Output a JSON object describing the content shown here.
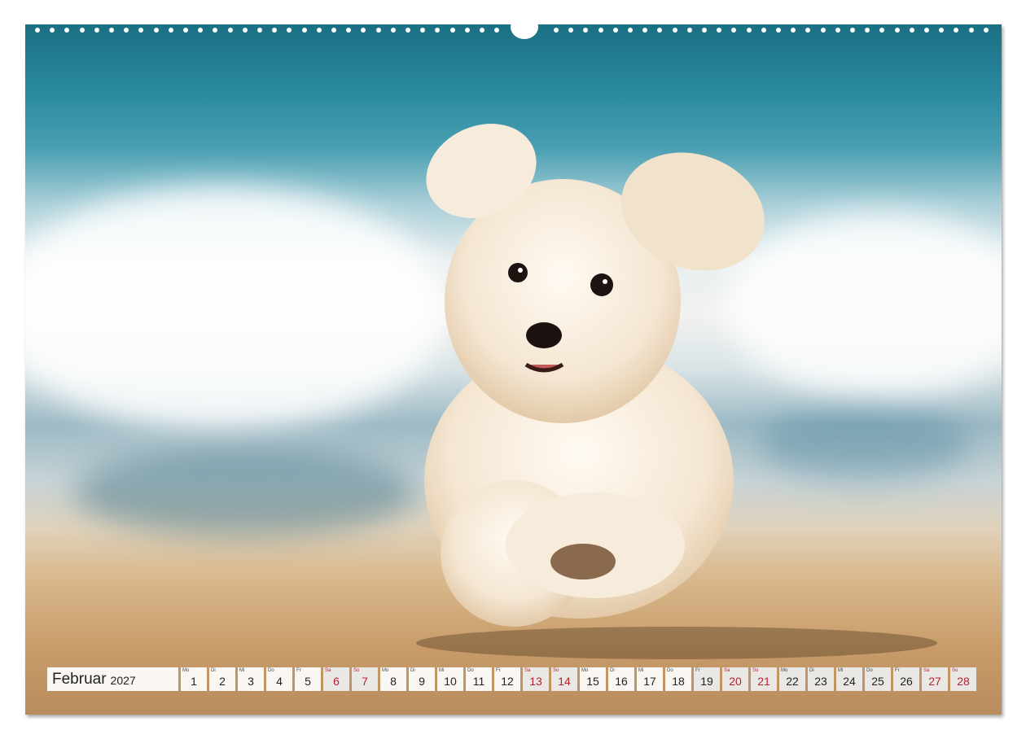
{
  "calendar": {
    "month": "Februar",
    "year": "2027",
    "days": [
      {
        "wd": "Mo",
        "d": "1",
        "type": "weekday"
      },
      {
        "wd": "Di",
        "d": "2",
        "type": "weekday"
      },
      {
        "wd": "Mi",
        "d": "3",
        "type": "weekday"
      },
      {
        "wd": "Do",
        "d": "4",
        "type": "weekday"
      },
      {
        "wd": "Fr",
        "d": "5",
        "type": "weekday"
      },
      {
        "wd": "Sa",
        "d": "6",
        "type": "sunday"
      },
      {
        "wd": "So",
        "d": "7",
        "type": "sunday"
      },
      {
        "wd": "Mo",
        "d": "8",
        "type": "weekday"
      },
      {
        "wd": "Di",
        "d": "9",
        "type": "weekday"
      },
      {
        "wd": "Mi",
        "d": "10",
        "type": "weekday"
      },
      {
        "wd": "Do",
        "d": "11",
        "type": "weekday"
      },
      {
        "wd": "Fr",
        "d": "12",
        "type": "weekday"
      },
      {
        "wd": "Sa",
        "d": "13",
        "type": "sunday"
      },
      {
        "wd": "So",
        "d": "14",
        "type": "sunday"
      },
      {
        "wd": "Mo",
        "d": "15",
        "type": "weekday"
      },
      {
        "wd": "Di",
        "d": "16",
        "type": "weekday"
      },
      {
        "wd": "Mi",
        "d": "17",
        "type": "weekday"
      },
      {
        "wd": "Do",
        "d": "18",
        "type": "weekday"
      },
      {
        "wd": "Fr",
        "d": "19",
        "type": "weekend"
      },
      {
        "wd": "Sa",
        "d": "20",
        "type": "sunday"
      },
      {
        "wd": "So",
        "d": "21",
        "type": "sunday"
      },
      {
        "wd": "Mo",
        "d": "22",
        "type": "weekend"
      },
      {
        "wd": "Di",
        "d": "23",
        "type": "weekend"
      },
      {
        "wd": "Mi",
        "d": "24",
        "type": "weekend"
      },
      {
        "wd": "Do",
        "d": "25",
        "type": "weekend"
      },
      {
        "wd": "Fr",
        "d": "26",
        "type": "weekend"
      },
      {
        "wd": "Sa",
        "d": "27",
        "type": "sunday"
      },
      {
        "wd": "So",
        "d": "28",
        "type": "sunday"
      }
    ]
  },
  "photo": {
    "subject": "white-fluffy-dog-running-on-beach"
  },
  "colors": {
    "sunday_red": "#b8202f",
    "sea_teal": "#2a8aa0",
    "sand": "#c99c6a"
  }
}
